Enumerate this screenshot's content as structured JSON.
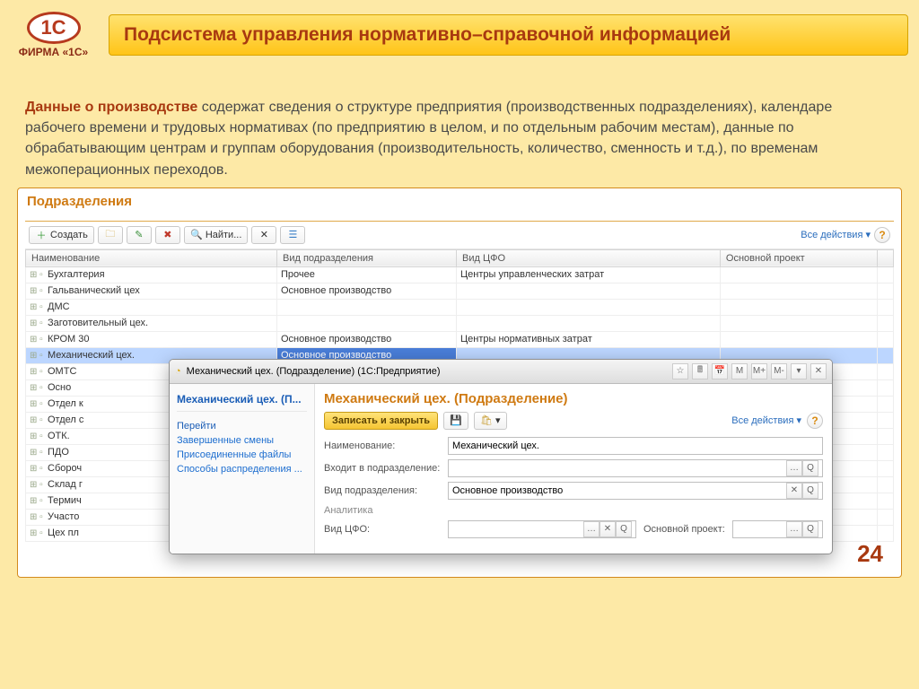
{
  "logo_text": "ФИРМА «1С»",
  "page_title": "Подсистема управления нормативно–справочной информацией",
  "intro_bold": "Данные о производстве",
  "intro_rest": " содержат сведения о структуре предприятия (производственных подразделениях), календаре рабочего времени и трудовых нормативах (по предприятию в целом, и по отдельным рабочим местам), данные по обрабатывающим центрам и группам оборудования (производительность, количество, сменность и т.д.), по временам межоперационных переходов.",
  "panel_title": "Подразделения",
  "toolbar": {
    "create": "Создать",
    "find": "Найти...",
    "all_actions": "Все действия"
  },
  "columns": [
    "Наименование",
    "Вид подразделения",
    "Вид ЦФО",
    "Основной проект"
  ],
  "rows": [
    {
      "n": "Бухгалтерия",
      "v": "Прочее",
      "c": "Центры управленческих затрат",
      "p": ""
    },
    {
      "n": "Гальванический цех",
      "v": "Основное производство",
      "c": "",
      "p": ""
    },
    {
      "n": "ДМС",
      "v": "",
      "c": "",
      "p": ""
    },
    {
      "n": "Заготовительный цех.",
      "v": "",
      "c": "",
      "p": ""
    },
    {
      "n": "КРОМ 30",
      "v": "Основное производство",
      "c": "Центры нормативных затрат",
      "p": ""
    },
    {
      "n": "Механический цех.",
      "v": "Основное производство",
      "c": "",
      "p": "",
      "sel": true
    },
    {
      "n": "ОМТС",
      "v": "",
      "c": "",
      "p": ""
    },
    {
      "n": "Осно",
      "v": "",
      "c": "",
      "p": ""
    },
    {
      "n": "Отдел к",
      "v": "",
      "c": "",
      "p": ""
    },
    {
      "n": "Отдел с",
      "v": "",
      "c": "",
      "p": ""
    },
    {
      "n": "ОТК.",
      "v": "",
      "c": "",
      "p": ""
    },
    {
      "n": "ПДО",
      "v": "",
      "c": "",
      "p": ""
    },
    {
      "n": "Сбороч",
      "v": "",
      "c": "",
      "p": ""
    },
    {
      "n": "Склад г",
      "v": "",
      "c": "",
      "p": ""
    },
    {
      "n": "Термич",
      "v": "",
      "c": "",
      "p": ""
    },
    {
      "n": "Участо",
      "v": "",
      "c": "",
      "p": ""
    },
    {
      "n": "Цех пл",
      "v": "",
      "c": "",
      "p": ""
    }
  ],
  "dialog": {
    "title": "Механический цех. (Подразделение) (1С:Предприятие)",
    "nav_current": "Механический цех. (П...",
    "nav_section": "Перейти",
    "nav_links": [
      "Завершенные смены",
      "Присоединенные файлы",
      "Способы распределения ..."
    ],
    "heading": "Механический цех. (Подразделение)",
    "save_close": "Записать и закрыть",
    "all_actions": "Все действия",
    "fields": {
      "name_label": "Наименование:",
      "name_value": "Механический цех.",
      "parent_label": "Входит в подразделение:",
      "parent_value": "",
      "type_label": "Вид подразделения:",
      "type_value": "Основное производство",
      "section": "Аналитика",
      "cfo_label": "Вид ЦФО:",
      "cfo_value": "",
      "proj_label": "Основной проект:",
      "proj_value": ""
    }
  },
  "slide_number": "24"
}
